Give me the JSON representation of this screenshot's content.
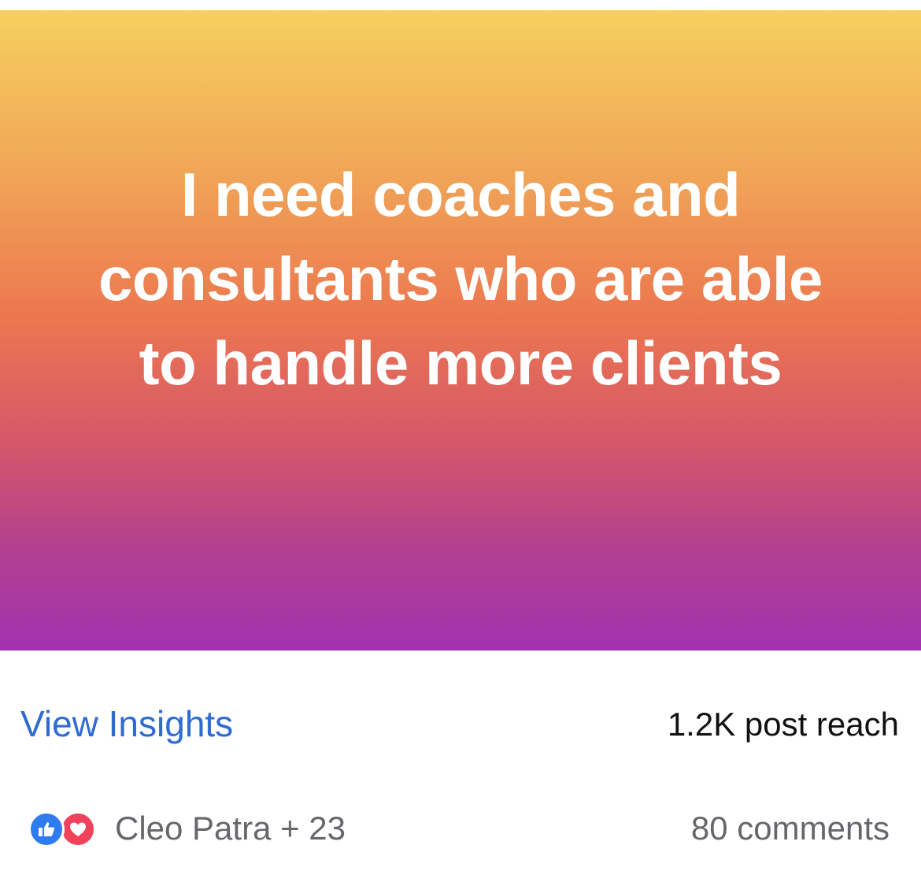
{
  "post": {
    "text": "I need coaches and consultants who are able to handle more clients",
    "gradient_colors": [
      "#f6d05e",
      "#ec774f",
      "#a132ae"
    ]
  },
  "insights": {
    "link_label": "View Insights",
    "reach": "1.2K post reach",
    "link_color": "#2f6bd1"
  },
  "reactions": {
    "icons": [
      "like-icon",
      "love-icon"
    ],
    "names": "Cleo Patra + 23",
    "comments": "80 comments"
  }
}
